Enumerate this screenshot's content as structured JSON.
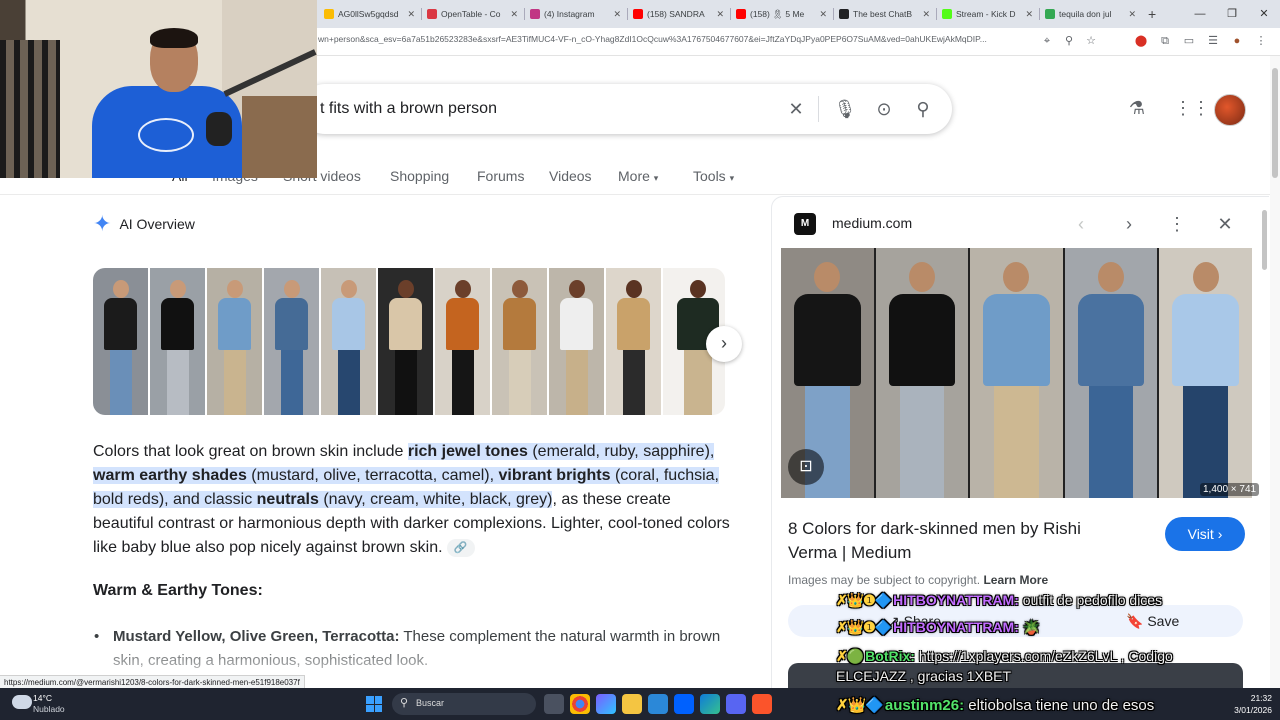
{
  "browser": {
    "tabs": [
      {
        "title": "AG0llSw5gqdsd",
        "color": "#fbbc04"
      },
      {
        "title": "OpenTable - Co",
        "color": "#da3743"
      },
      {
        "title": "(4) Instagram",
        "color": "#c13584"
      },
      {
        "title": "(158) SANDRA",
        "color": "#ff0000"
      },
      {
        "title": "(158) 🎗 5 Me",
        "color": "#ff0000"
      },
      {
        "title": "The best ChatB",
        "color": "#202124"
      },
      {
        "title": "Stream - Kick D",
        "color": "#53fc18"
      },
      {
        "title": "tequila don jul",
        "color": "#34a853"
      }
    ],
    "url": "wn+person&sca_esv=6a7a51b26523283e&sxsrf=AE3TifMUC4-VF-n_cO-Yhag8ZdI1OcQcuw%3A1767504677607&ei=JftZaYDqJPya0PEP6O7SuAM&ved=0ahUKEwjAkMqDIP...",
    "status_url": "https://medium.com/@vermarishi1203/8-colors-for-dark-skinned-men-e51f918e037f"
  },
  "search": {
    "query": "t fits with a brown person"
  },
  "nav": {
    "items": [
      "All",
      "Images",
      "Short videos",
      "Shopping",
      "Forums",
      "Videos",
      "More",
      "Tools"
    ]
  },
  "ai_overview": {
    "title": "AI Overview",
    "para": {
      "p1": "Colors that look great on brown skin include ",
      "h1b": "rich jewel tones",
      "h1n": " (emerald, ruby, sapphire), ",
      "h2b": "warm earthy shades",
      "h2n": " (mustard, olive, terracotta, camel), ",
      "h3b": "vibrant brights",
      "h3n": " (coral, fuchsia, bold reds), and classic ",
      "h4b": "neutrals",
      "h4n": " (navy, cream, white, black, grey)",
      "p2": ", as these create beautiful contrast or harmonious depth with darker complexions. Lighter, cool-toned colors like baby blue also pop nicely against brown skin."
    },
    "section_heading": "Warm & Earthy Tones:",
    "bullet_bold": "Mustard Yellow, Olive Green, Terracotta:",
    "bullet_text": " These complement the natural warmth in brown skin, creating a harmonious, sophisticated look."
  },
  "panel": {
    "source": "medium.com",
    "favicon": "M",
    "dimensions": "1,400 × 741",
    "title": "8 Colors for dark-skinned men by Rishi Verma | Medium",
    "visit_label": "Visit",
    "copyright": "Images may be subject to copyright.",
    "learn_more": "Learn More",
    "share_label": "Share",
    "save_label": "Save"
  },
  "chat": [
    {
      "badges": "✗👑❶🔷",
      "user": "HITBOYNATTRAM:",
      "msg": "outfit de pedofilo dices"
    },
    {
      "badges": "✗👑❶🔷",
      "user": "HITBOYNATTRAM:",
      "msg": "🪴"
    },
    {
      "badges": "✗🟢",
      "user": "BotRix:",
      "msg": "https://1xplayers.com/eZkZ6LvL , Codigo"
    },
    {
      "badges": "",
      "user": "",
      "msg": "ELCEJAZZ , gracias 1XBET"
    },
    {
      "badges": "✗👑🔷",
      "user": "austinm26:",
      "msg": "eltiobolsa tiene uno de esos"
    }
  ],
  "taskbar": {
    "temp": "14°C",
    "weather": "Nublado",
    "search_placeholder": "Buscar",
    "time": "21:32",
    "date": "3/01/2026"
  }
}
